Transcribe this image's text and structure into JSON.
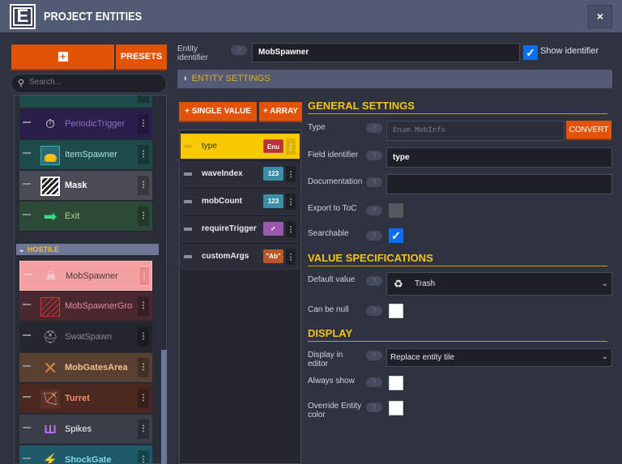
{
  "header": {
    "logo": "E",
    "title": "PROJECT ENTITIES",
    "close": "×"
  },
  "sidebar": {
    "add_icon": "+",
    "presets": "PRESETS",
    "search_placeholder": "Search...",
    "items_top": [
      {
        "label": "PeriodicTrigger",
        "icon": "⏱"
      },
      {
        "label": "ItemSpawner",
        "icon": "👝"
      },
      {
        "label": "Mask",
        "icon": ""
      },
      {
        "label": "Exit",
        "icon": "➡"
      }
    ],
    "group": "HOSTILE",
    "items_hostile": [
      {
        "label": "MobSpawner",
        "icon": "☠"
      },
      {
        "label": "MobSpawnerGroup",
        "icon": ""
      },
      {
        "label": "SwatSpawn",
        "icon": "⛑"
      },
      {
        "label": "MobGatesArea",
        "icon": "✕"
      },
      {
        "label": "Turret",
        "icon": "🏹"
      },
      {
        "label": "Spikes",
        "icon": "Ш"
      },
      {
        "label": "ShockGate",
        "icon": "⚡"
      }
    ]
  },
  "entity": {
    "identifier_label": "Entity identifier",
    "identifier_value": "MobSpawner",
    "show_identifier": "Show identifier",
    "show_identifier_checked": true,
    "settings_label": "ENTITY SETTINGS"
  },
  "fields": {
    "add_single": "+ SINGLE VALUE",
    "add_array": "+ ARRAY",
    "list": [
      {
        "name": "type",
        "badge": "Enu",
        "color": "#b8323a"
      },
      {
        "name": "waveIndex",
        "badge": "123",
        "color": "#3a8ea8"
      },
      {
        "name": "mobCount",
        "badge": "123",
        "color": "#3a8ea8"
      },
      {
        "name": "requireTrigger",
        "badge": "✓",
        "color": "#9a58b0"
      },
      {
        "name": "customArgs",
        "badge": "\"Ab\"",
        "color": "#b8582a"
      }
    ]
  },
  "general": {
    "title": "GENERAL SETTINGS",
    "type_label": "Type",
    "type_value": "Enum.MobInfo",
    "convert": "CONVERT",
    "field_id_label": "Field identifier",
    "field_id_value": "type",
    "doc_label": "Documentation",
    "doc_value": "",
    "export_label": "Export to ToC",
    "searchable_label": "Searchable",
    "help": "?"
  },
  "value_spec": {
    "title": "VALUE SPECIFICATIONS",
    "default_label": "Default value",
    "default_value": "Trash",
    "null_label": "Can be null"
  },
  "display": {
    "title": "DISPLAY",
    "display_label": "Display in editor",
    "display_value": "Replace entity tile",
    "always_label": "Always show",
    "override_label": "Override Entity color"
  }
}
